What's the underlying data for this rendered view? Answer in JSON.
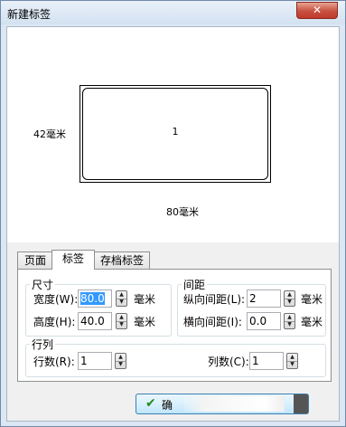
{
  "window": {
    "title": "新建标签",
    "close_glyph": "✕"
  },
  "preview": {
    "label_number": "1",
    "height_text": "42毫米",
    "width_text": "80毫米"
  },
  "tabs": [
    {
      "label": "页面",
      "active": false
    },
    {
      "label": "标签",
      "active": true
    },
    {
      "label": "存档标签",
      "active": false
    }
  ],
  "size_group": {
    "title": "尺寸",
    "width_label": "宽度(W):",
    "width_value": "80.0",
    "height_label": "高度(H):",
    "height_value": "40.0",
    "unit": "毫米"
  },
  "gap_group": {
    "title": "间距",
    "vgap_label": "纵向间距(L):",
    "vgap_value": "2",
    "hgap_label": "横向间距(I):",
    "hgap_value": "0.0",
    "unit": "毫米"
  },
  "rows_cols_group": {
    "title": "行列",
    "rows_label": "行数(R):",
    "rows_value": "1",
    "cols_label": "列数(C):",
    "cols_value": "1"
  },
  "ok_button": {
    "label": "确",
    "icon": "check-icon"
  },
  "colors": {
    "selection": "#3399ff",
    "ok_check": "#1f8a1f",
    "close_button": "#c7503f"
  }
}
